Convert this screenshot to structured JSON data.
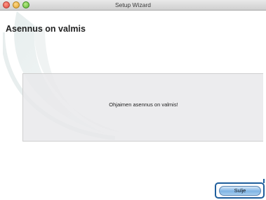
{
  "window": {
    "title": "Setup Wizard"
  },
  "page": {
    "heading": "Asennus on valmis",
    "message": "Ohjaimen asennus on valmis!"
  },
  "buttons": {
    "close_label": "Sulje"
  },
  "colors": {
    "highlight": "#1f5e9c",
    "button_top": "#d6e8f8",
    "button_bottom": "#7fb4e4"
  },
  "icons": {
    "close": "close-window-icon",
    "minimize": "minimize-window-icon",
    "maximize": "zoom-window-icon"
  }
}
